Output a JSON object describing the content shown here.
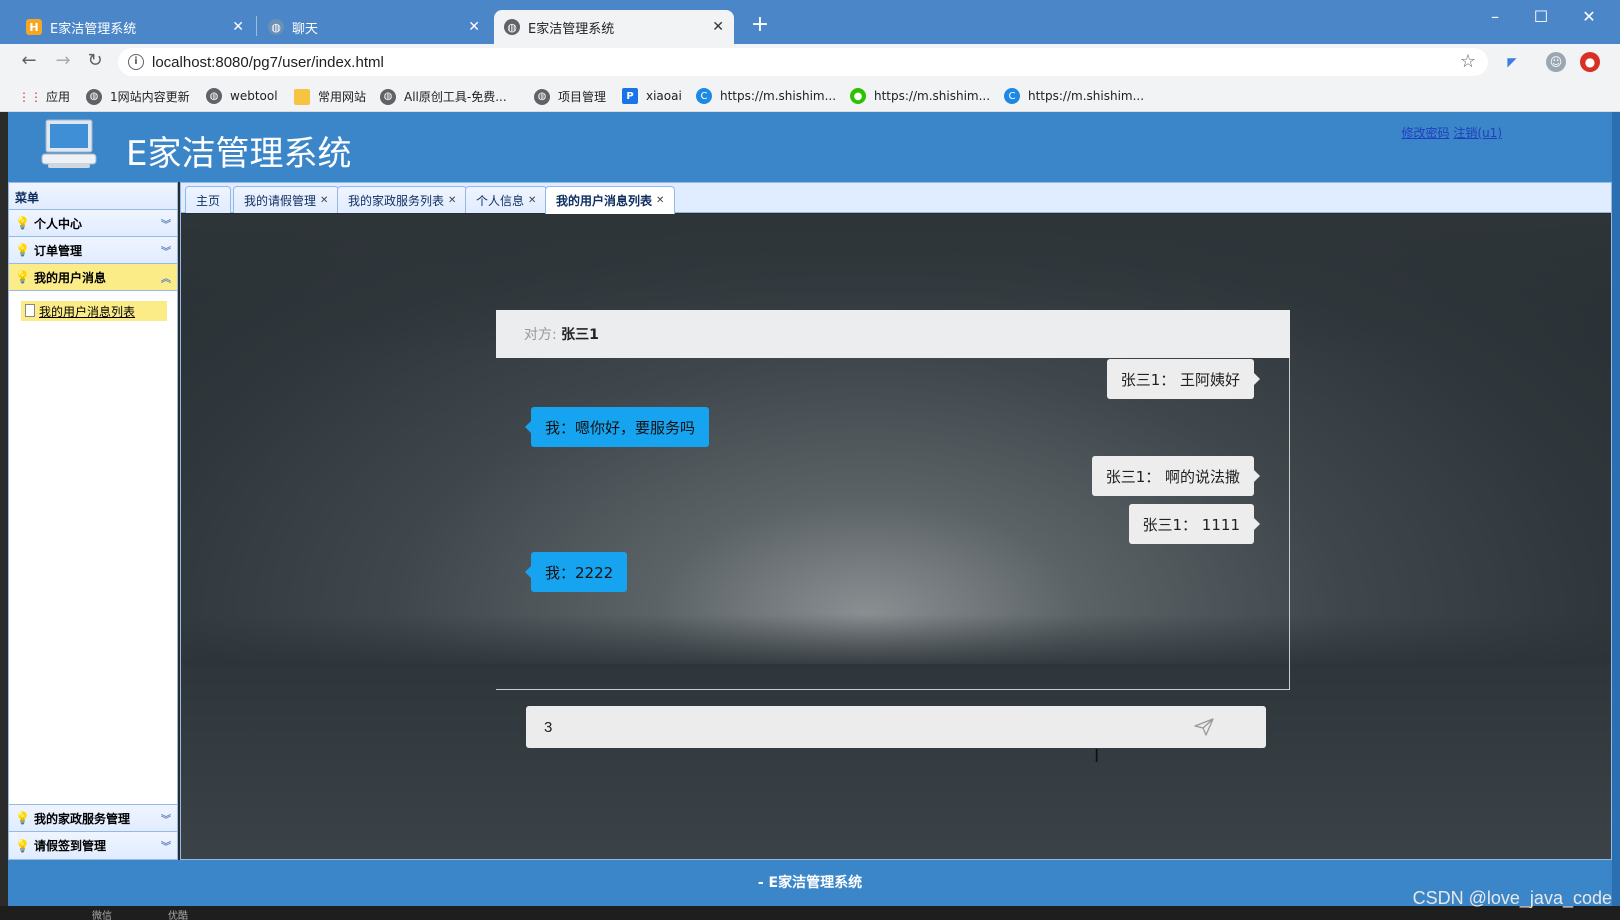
{
  "browser": {
    "tabs": [
      {
        "title": "E家洁管理系统",
        "active": false
      },
      {
        "title": "聊天",
        "active": false
      },
      {
        "title": "E家洁管理系统",
        "active": true
      }
    ],
    "new_tab": "+",
    "url": "localhost:8080/pg7/user/index.html",
    "bookmarks": [
      "应用",
      "1网站内容更新",
      "webtool",
      "常用网站",
      "All原创工具-免费...",
      "项目管理",
      "xiaoai",
      "https://m.shishim...",
      "https://m.shishim...",
      "https://m.shishim..."
    ]
  },
  "app": {
    "title": "E家洁管理系统",
    "links": {
      "change_password": "修改密码",
      "logout": "注销(u1)"
    }
  },
  "sidebar": {
    "title": "菜单",
    "sections": [
      {
        "label": "个人中心"
      },
      {
        "label": "订单管理"
      },
      {
        "label": "我的用户消息",
        "expanded": true,
        "items": [
          "我的用户消息列表"
        ]
      },
      {
        "label": "我的家政服务管理"
      },
      {
        "label": "请假签到管理"
      }
    ]
  },
  "page_tabs": [
    "主页",
    "我的请假管理",
    "我的家政服务列表",
    "个人信息",
    "我的用户消息列表"
  ],
  "chat": {
    "peer_label": "对方:",
    "peer_name": "张三1",
    "messages": [
      {
        "side": "right",
        "text": "张三1： 王阿姨好"
      },
      {
        "side": "left",
        "text": "我：嗯你好，要服务吗"
      },
      {
        "side": "right",
        "text": "张三1： 啊的说法撒"
      },
      {
        "side": "right",
        "text": "张三1： 1111"
      },
      {
        "side": "left",
        "text": "我：2222"
      }
    ],
    "input_value": "3",
    "send_icon": "send-icon"
  },
  "footer": {
    "text": "- E家洁管理系统"
  },
  "taskbar": {
    "items": [
      "微信",
      "优酷"
    ]
  },
  "watermark": "CSDN @love_java_code",
  "colors": {
    "header_blue": "#3b86c9",
    "bubble_me": "#16a4f0",
    "bubble_peer": "#ededed",
    "menu_selected": "#fbec88"
  }
}
